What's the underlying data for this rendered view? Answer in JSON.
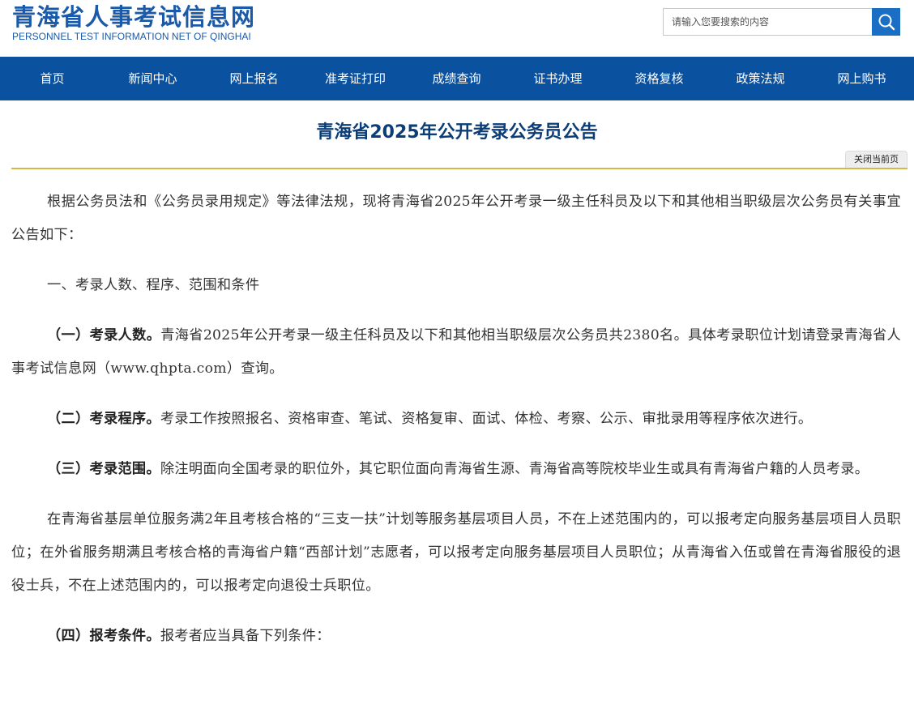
{
  "header": {
    "site_title": "青海省人事考试信息网",
    "site_subtitle": "PERSONNEL TEST INFORMATION NET OF QINGHAI",
    "search": {
      "placeholder": "请输入您要搜索的内容",
      "value": "",
      "icon": "search-icon"
    }
  },
  "nav": {
    "items": [
      {
        "label": "首页"
      },
      {
        "label": "新闻中心"
      },
      {
        "label": "网上报名"
      },
      {
        "label": "准考证打印"
      },
      {
        "label": "成绩查询"
      },
      {
        "label": "证书办理"
      },
      {
        "label": "资格复核"
      },
      {
        "label": "政策法规"
      },
      {
        "label": "网上购书"
      }
    ]
  },
  "article": {
    "title": "青海省2025年公开考录公务员公告",
    "close_label": "关闭当前页",
    "intro": "根据公务员法和《公务员录用规定》等法律法规，现将青海省2025年公开考录一级主任科员及以下和其他相当职级层次公务员有关事宜公告如下：",
    "section1_heading": "一、考录人数、程序、范围和条件",
    "item1_label": "（一）考录人数。",
    "item1_text": "青海省2025年公开考录一级主任科员及以下和其他相当职级层次公务员共2380名。具体考录职位计划请登录青海省人事考试信息网（www.qhpta.com）查询。",
    "item2_label": "（二）考录程序。",
    "item2_text": "考录工作按照报名、资格审查、笔试、资格复审、面试、体检、考察、公示、审批录用等程序依次进行。",
    "item3_label": "（三）考录范围。",
    "item3_text": "除注明面向全国考录的职位外，其它职位面向青海省生源、青海省高等院校毕业生或具有青海省户籍的人员考录。",
    "item3_extra": "在青海省基层单位服务满2年且考核合格的“三支一扶”计划等服务基层项目人员，不在上述范围内的，可以报考定向服务基层项目人员职位；在外省服务期满且考核合格的青海省户籍“西部计划”志愿者，可以报考定向服务基层项目人员职位；从青海省入伍或曾在青海省服役的退役士兵，不在上述范围内的，可以报考定向退役士兵职位。",
    "item4_label": "（四）报考条件。",
    "item4_text": "报考者应当具备下列条件："
  },
  "colors": {
    "brand_blue": "#1a5aa8",
    "nav_bg": "#0a519f",
    "title_color": "#0b3e78",
    "divider": "#d9b84a"
  }
}
